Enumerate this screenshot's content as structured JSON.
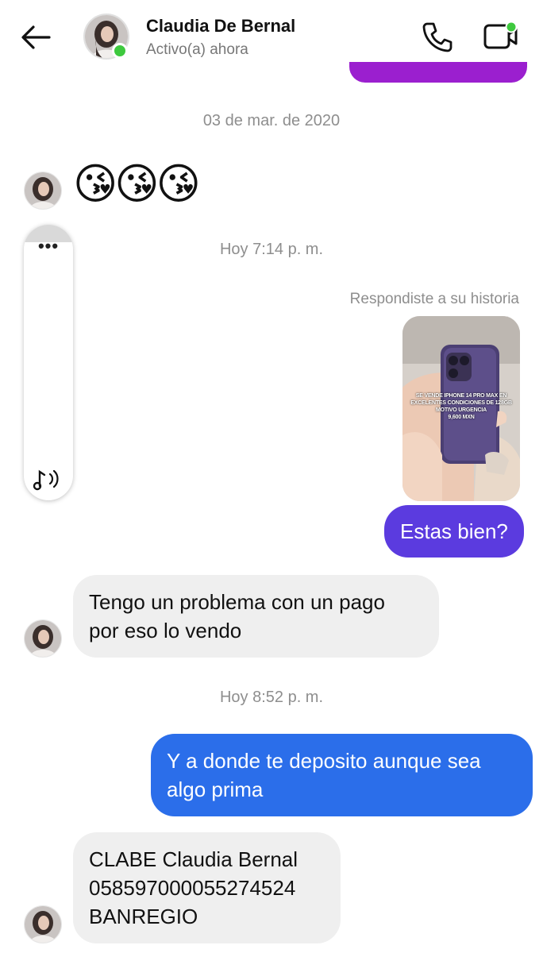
{
  "header": {
    "contact_name": "Claudia De Bernal",
    "status": "Activo(a) ahora"
  },
  "colors": {
    "outgoing_purple": "#5b3bdf",
    "outgoing_blue": "#2b6eea",
    "previous_bubble_magenta": "#9b1fcf",
    "incoming_bg": "#efefef",
    "online_green": "#3ec93e"
  },
  "icons": {
    "back": "back-arrow-icon",
    "call": "phone-icon",
    "video": "video-call-icon",
    "audio": "sound-icon"
  },
  "timestamps": {
    "date": "03 de mar. de 2020",
    "first": "Hoy 7:14 p. m.",
    "second": "Hoy 8:52 p. m."
  },
  "story_reply": {
    "label": "Respondiste a su historia",
    "caption": "SE VENDE IPHONE 14 PRO MAX EN\nEXCELENTES CONDICIONES DE 128GB\nMOTIVO URGENCIA\n9,600 MXN"
  },
  "audio": {
    "dots": "•••"
  },
  "messages": [
    {
      "from": "them",
      "text": "😘😘😘"
    },
    {
      "from": "me",
      "text": "Estas bien?"
    },
    {
      "from": "them",
      "lines": [
        "Tengo un problema con un pago",
        "por eso lo vendo"
      ]
    },
    {
      "from": "me",
      "lines": [
        "Y a donde te deposito aunque sea",
        "algo prima"
      ]
    },
    {
      "from": "them",
      "lines": [
        "CLABE  Claudia Bernal",
        "058597000055274524",
        "BANREGIO"
      ]
    }
  ]
}
